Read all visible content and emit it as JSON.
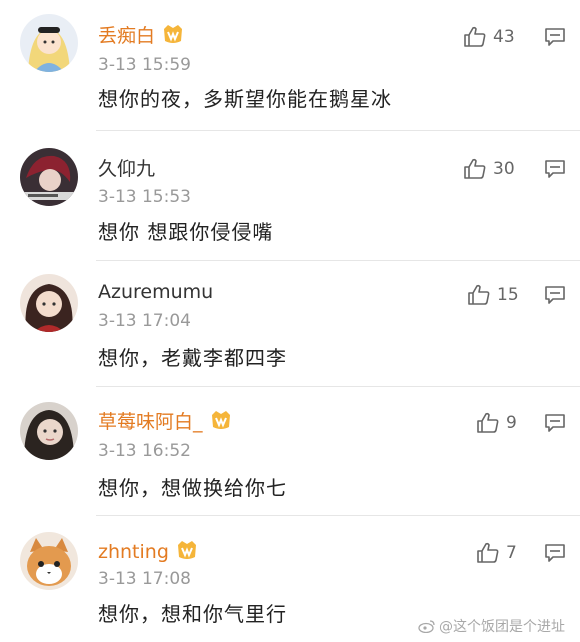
{
  "comments": [
    {
      "username": "丢痴白",
      "timestamp": "3-13 15:59",
      "content": "想你的夜，多斯望你能在鹅星冰",
      "likes": "43",
      "vip": true
    },
    {
      "username": "久仰九",
      "timestamp": "3-13 15:53",
      "content": "想你 想跟你侵侵嘴",
      "likes": "30",
      "vip": false
    },
    {
      "username": "Azuremumu",
      "timestamp": "3-13 17:04",
      "content": "想你，老戴李都四李",
      "likes": "15",
      "vip": false
    },
    {
      "username": "草莓味阿白_",
      "timestamp": "3-13 16:52",
      "content": "想你，想做换给你七",
      "likes": "9",
      "vip": true
    },
    {
      "username": "zhnting",
      "timestamp": "3-13 17:08",
      "content": "想你，想和你气里行",
      "likes": "7",
      "vip": true
    }
  ],
  "watermark": "@这个饭团是个进址",
  "colors": {
    "vip_name": "#e37b22",
    "plain_name": "#333333",
    "meta": "#999999",
    "text": "#222222"
  }
}
